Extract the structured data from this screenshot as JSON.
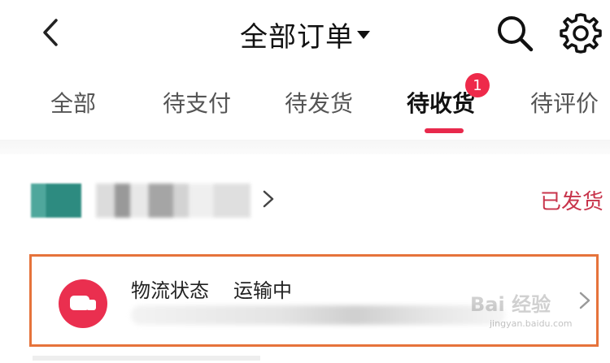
{
  "header": {
    "title": "全部订单",
    "icons": {
      "back": "chevron-left-icon",
      "search": "search-icon",
      "settings": "gear-icon",
      "dropdown": "caret-down-icon"
    }
  },
  "tabs": [
    {
      "label": "全部",
      "active": false
    },
    {
      "label": "待支付",
      "active": false
    },
    {
      "label": "待发货",
      "active": false
    },
    {
      "label": "待收货",
      "active": true,
      "badge": "1"
    },
    {
      "label": "待评价",
      "active": false
    }
  ],
  "order": {
    "status": "已发货",
    "logistics": {
      "label": "物流状态",
      "value": "运输中",
      "icon": "truck-icon"
    }
  },
  "watermark": {
    "brand": "Bai 经验",
    "sub": "jingyan.baidu.com"
  },
  "colors": {
    "accent": "#e8294c",
    "status": "#c8344b",
    "highlight_border": "#e6733b"
  }
}
